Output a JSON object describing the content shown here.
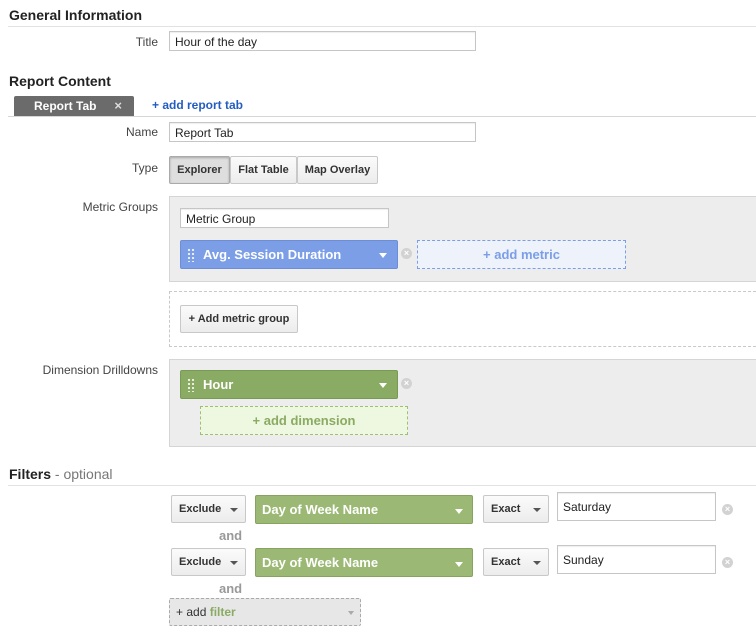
{
  "general": {
    "heading": "General Information",
    "title_label": "Title",
    "title_value": "Hour of the day"
  },
  "content": {
    "heading": "Report Content",
    "tab_label": "Report Tab",
    "tab_close": "×",
    "add_tab": "+ add report tab",
    "name_label": "Name",
    "name_value": "Report Tab",
    "type_label": "Type",
    "types": [
      "Explorer",
      "Flat Table",
      "Map Overlay"
    ],
    "selected_type": "Explorer",
    "metric_groups_label": "Metric Groups",
    "metric_group_name": "Metric Group",
    "metric": "Avg. Session Duration",
    "add_metric": "+ add metric",
    "add_metric_group": "+ Add metric group",
    "dimension_label": "Dimension Drilldowns",
    "dimension": "Hour",
    "add_dimension": "+ add dimension"
  },
  "filters": {
    "heading": "Filters",
    "optional": " - optional",
    "rows": [
      {
        "mode": "Exclude",
        "field": "Day of Week Name",
        "match": "Exact",
        "value": "Saturday"
      },
      {
        "mode": "Exclude",
        "field": "Day of Week Name",
        "match": "Exact",
        "value": "Sunday"
      }
    ],
    "and": "and",
    "add_prefix": "+ add ",
    "add_word": "filter"
  },
  "colors": {
    "metric": "#7b9ee6",
    "dimension": "#8aab63",
    "filter_field": "#9bb874",
    "tab": "#6b6b6b",
    "link": "#245dc1"
  },
  "icons": [
    "drag-handle-icon",
    "caret-down-icon",
    "remove-icon",
    "close-icon"
  ]
}
